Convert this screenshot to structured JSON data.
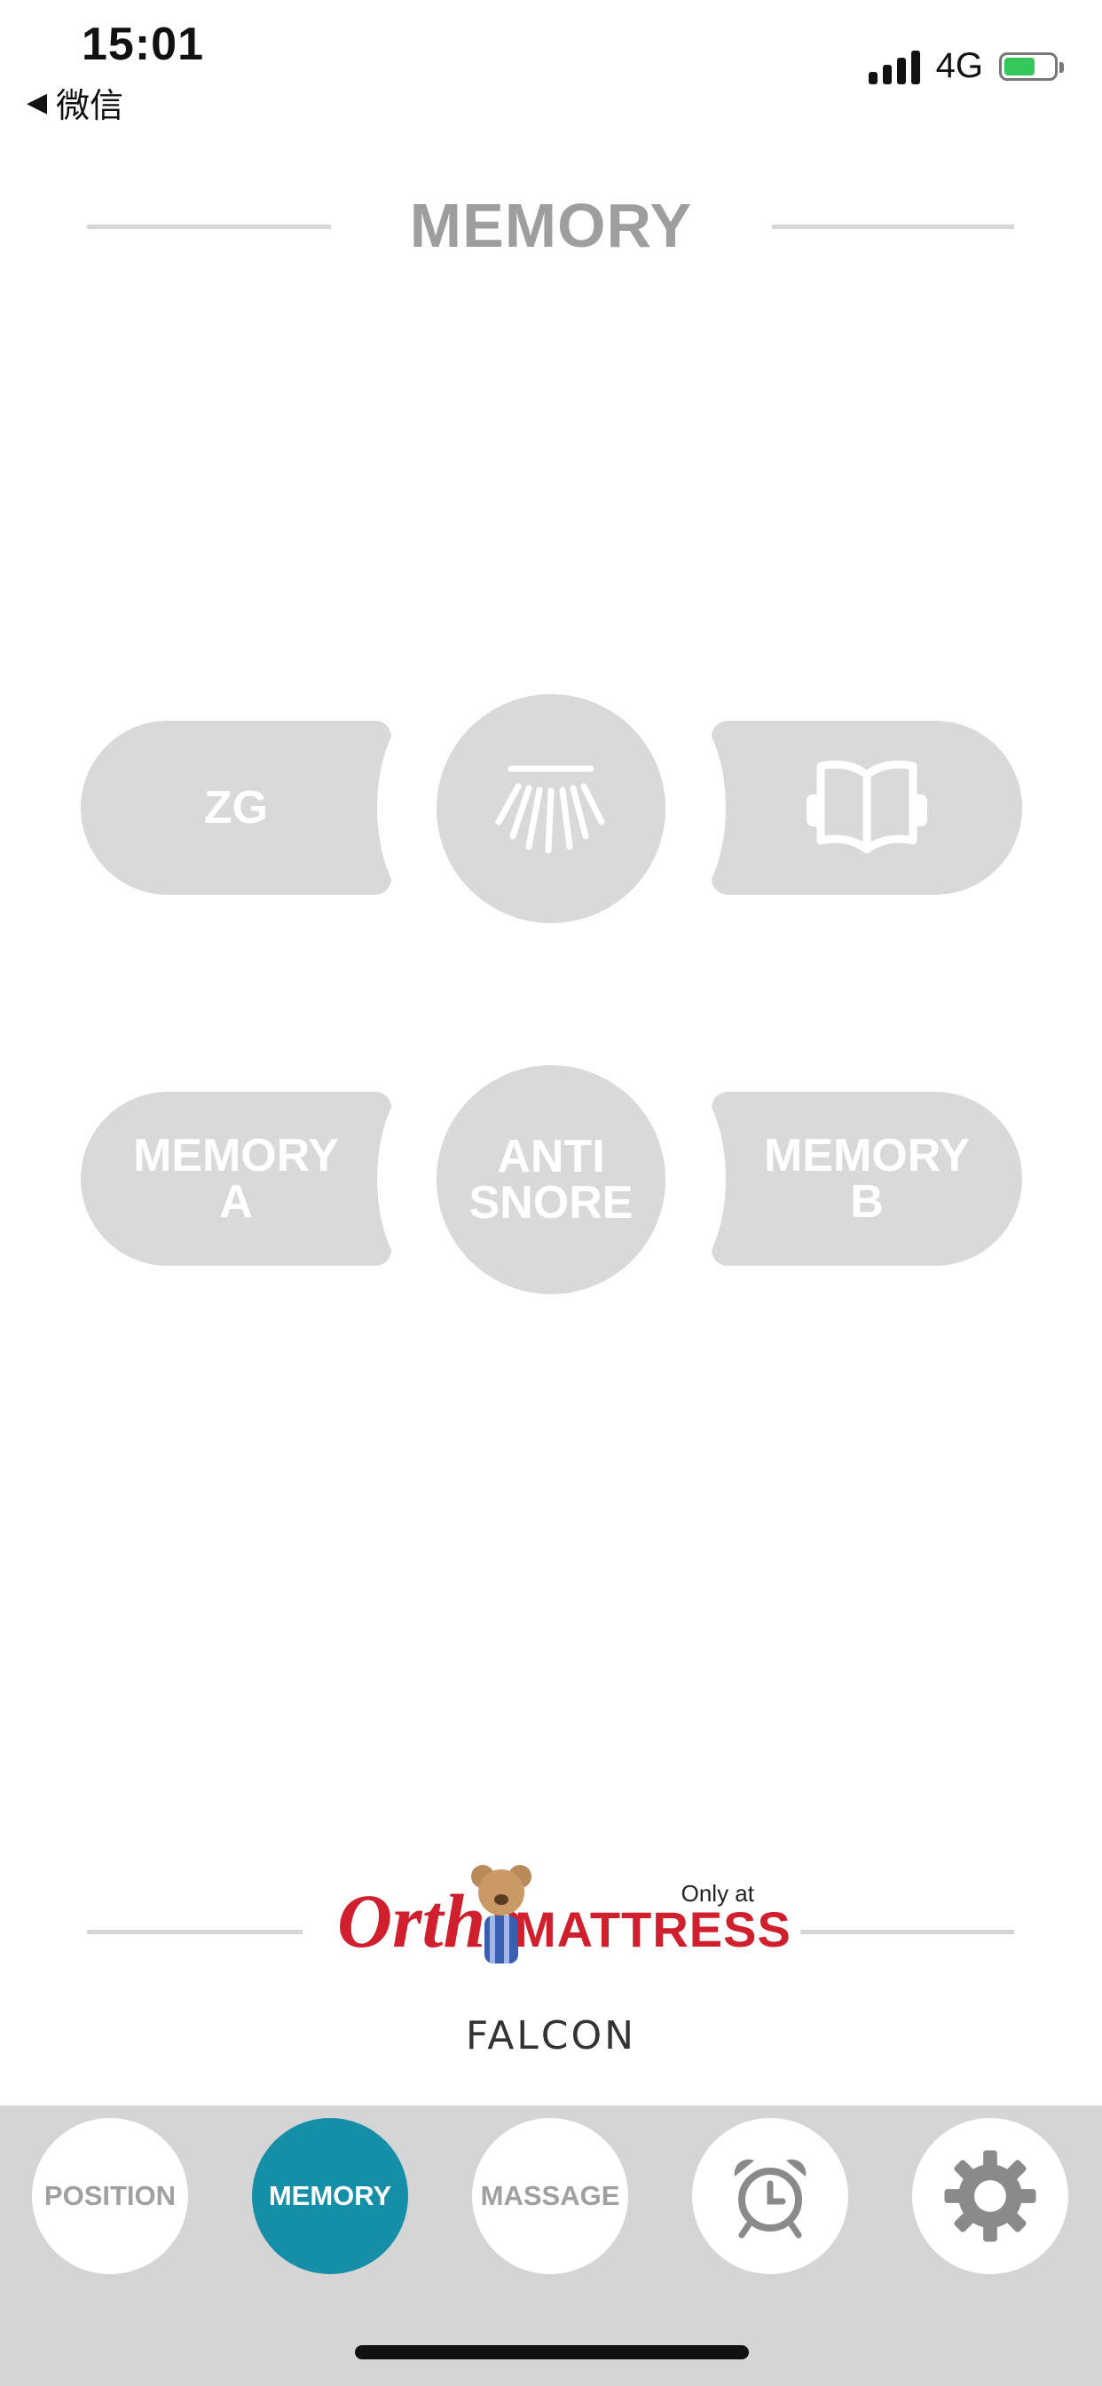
{
  "status": {
    "time": "15:01",
    "back_label": "微信",
    "network": "4G"
  },
  "section": {
    "title": "MEMORY"
  },
  "controls": {
    "zg": "ZG",
    "flat_icon": "flat-light-icon",
    "read_icon": "book-icon",
    "memory_a": "MEMORY\nA",
    "anti_snore": "ANTI\nSNORE",
    "memory_b": "MEMORY\nB"
  },
  "branding": {
    "logo_text_1": "Ortho",
    "logo_text_2": "MATTRESS",
    "only_at": "Only at",
    "model": "FALCON"
  },
  "nav": {
    "position": "POSITION",
    "memory": "MEMORY",
    "massage": "MASSAGE",
    "alarm_icon": "alarm-clock-icon",
    "settings_icon": "gear-icon",
    "active": "memory"
  },
  "colors": {
    "accent": "#158ea8",
    "button_gray": "#d9d9d9",
    "brand_red": "#d0202e"
  }
}
